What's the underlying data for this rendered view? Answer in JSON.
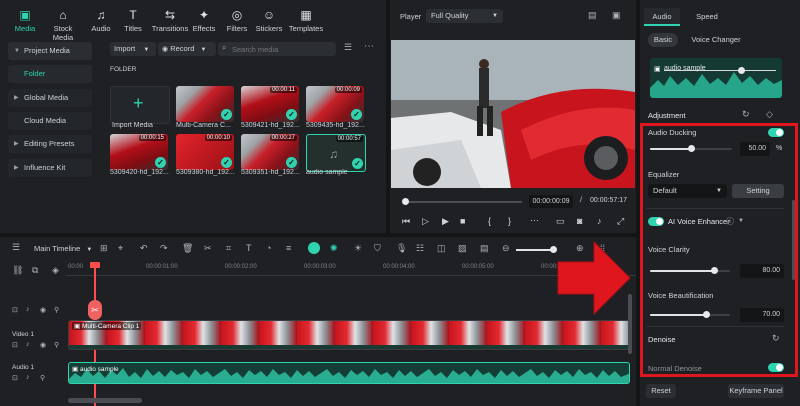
{
  "toolbar": {
    "items": [
      {
        "label": "Media",
        "icon": "media-icon"
      },
      {
        "label": "Stock Media",
        "icon": "stock-media-icon"
      },
      {
        "label": "Audio",
        "icon": "audio-icon"
      },
      {
        "label": "Titles",
        "icon": "titles-icon"
      },
      {
        "label": "Transitions",
        "icon": "transitions-icon"
      },
      {
        "label": "Effects",
        "icon": "effects-icon"
      },
      {
        "label": "Filters",
        "icon": "filters-icon"
      },
      {
        "label": "Stickers",
        "icon": "stickers-icon"
      },
      {
        "label": "Templates",
        "icon": "templates-icon"
      }
    ]
  },
  "sidebar": {
    "items": [
      {
        "label": "Project Media",
        "caret": "▼"
      },
      {
        "label": "Folder",
        "caret": ""
      },
      {
        "label": "Global Media",
        "caret": "▶"
      },
      {
        "label": "Cloud Media",
        "caret": ""
      },
      {
        "label": "Editing Presets",
        "caret": "▶"
      },
      {
        "label": "Influence Kit",
        "caret": "▶"
      }
    ]
  },
  "media": {
    "import_label": "Import",
    "record_label": "Record",
    "search_placeholder": "Search media",
    "folder_label": "FOLDER",
    "import_media_label": "Import Media",
    "items": [
      {
        "label": "Multi-Camera C...",
        "duration": ""
      },
      {
        "label": "5309421-hd_192...",
        "duration": "00:00:11"
      },
      {
        "label": "5309435-hd_192...",
        "duration": "00:00:09"
      },
      {
        "label": "5309420-hd_192...",
        "duration": "00:00:15"
      },
      {
        "label": "5309380-hd_192...",
        "duration": "00:00:10"
      },
      {
        "label": "5309351-hd_192...",
        "duration": "00:00:27"
      },
      {
        "label": "audio sample",
        "duration": "00:00:57"
      }
    ]
  },
  "player": {
    "label": "Player",
    "quality": "Full Quality",
    "current_time": "00:00:00:09",
    "total_time": "00:00:57:17",
    "separator": "/"
  },
  "timeline": {
    "name": "Main Timeline",
    "ticks": [
      "00:00",
      "00:00:01:00",
      "00:00:02:00",
      "00:00:03:00",
      "00:00:04:00",
      "00:00:05:00",
      "00:00:06:00"
    ],
    "video_track_label": "Video 1",
    "audio_track_label": "Audio 1",
    "video_clip_label": "Multi-Camera Clip 1",
    "audio_clip_label": "audio sample"
  },
  "right_panel": {
    "tabs": [
      "Audio",
      "Speed"
    ],
    "subtabs": [
      "Basic",
      "Voice Changer"
    ],
    "waveform_label": "audio sample",
    "adjustment_label": "Adjustment",
    "audio_ducking_label": "Audio Ducking",
    "audio_ducking_value": "50.00",
    "audio_ducking_unit": "%",
    "audio_ducking_level": 0.5,
    "equalizer_label": "Equalizer",
    "equalizer_value": "Default",
    "setting_label": "Setting",
    "ai_voice_label": "AI Voice Enhancer",
    "voice_clarity_label": "Voice Clarity",
    "voice_clarity_value": "80.00",
    "voice_clarity_level": 0.8,
    "voice_beautification_label": "Voice Beautification",
    "voice_beautification_value": "70.00",
    "voice_beautification_level": 0.7,
    "denoise_label": "Denoise",
    "normal_denoise_label": "Normal Denoise",
    "reset_label": "Reset",
    "keyframe_label": "Keyframe Panel"
  },
  "colors": {
    "accent": "#2fd3b0",
    "highlight": "#e0161e",
    "playhead": "#ff4d4d"
  }
}
